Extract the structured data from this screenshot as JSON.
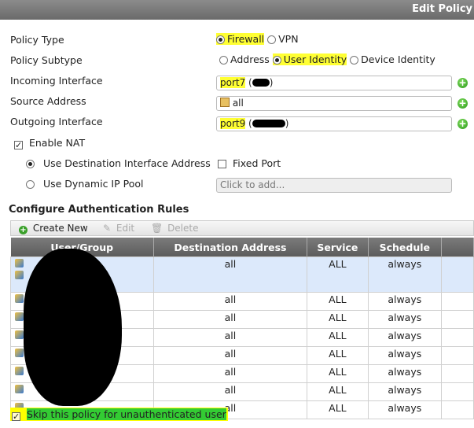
{
  "title": "Edit Policy",
  "policy_type": {
    "label": "Policy Type",
    "options": [
      "Firewall",
      "VPN"
    ],
    "selected": "Firewall"
  },
  "policy_subtype": {
    "label": "Policy Subtype",
    "options": [
      "Address",
      "User Identity",
      "Device Identity"
    ],
    "selected": "User Identity"
  },
  "incoming": {
    "label": "Incoming Interface",
    "value": "port7"
  },
  "source": {
    "label": "Source Address",
    "value": "all"
  },
  "outgoing": {
    "label": "Outgoing Interface",
    "value": "port9"
  },
  "nat": {
    "label": "Enable NAT",
    "checked": true,
    "dest_iface": "Use Destination Interface Address",
    "fixed_port": "Fixed Port",
    "dynamic_pool": "Use Dynamic IP Pool",
    "pool_placeholder": "Click to add..."
  },
  "auth": {
    "title": "Configure Authentication Rules",
    "toolbar": {
      "create": "Create New",
      "edit": "Edit",
      "delete": "Delete"
    },
    "columns": [
      "User/Group",
      "Destination Address",
      "Service",
      "Schedule"
    ],
    "rows": [
      {
        "dest": "all",
        "service": "ALL",
        "schedule": "always"
      },
      {
        "dest": "all",
        "service": "ALL",
        "schedule": "always"
      },
      {
        "dest": "all",
        "service": "ALL",
        "schedule": "always"
      },
      {
        "dest": "all",
        "service": "ALL",
        "schedule": "always"
      },
      {
        "dest": "all",
        "service": "ALL",
        "schedule": "always"
      },
      {
        "dest": "all",
        "service": "ALL",
        "schedule": "always"
      },
      {
        "dest": "all",
        "service": "ALL",
        "schedule": "always"
      },
      {
        "dest": "all",
        "service": "ALL",
        "schedule": "always"
      }
    ]
  },
  "skip": {
    "label": "Skip this policy for unauthenticated user",
    "checked": true
  }
}
